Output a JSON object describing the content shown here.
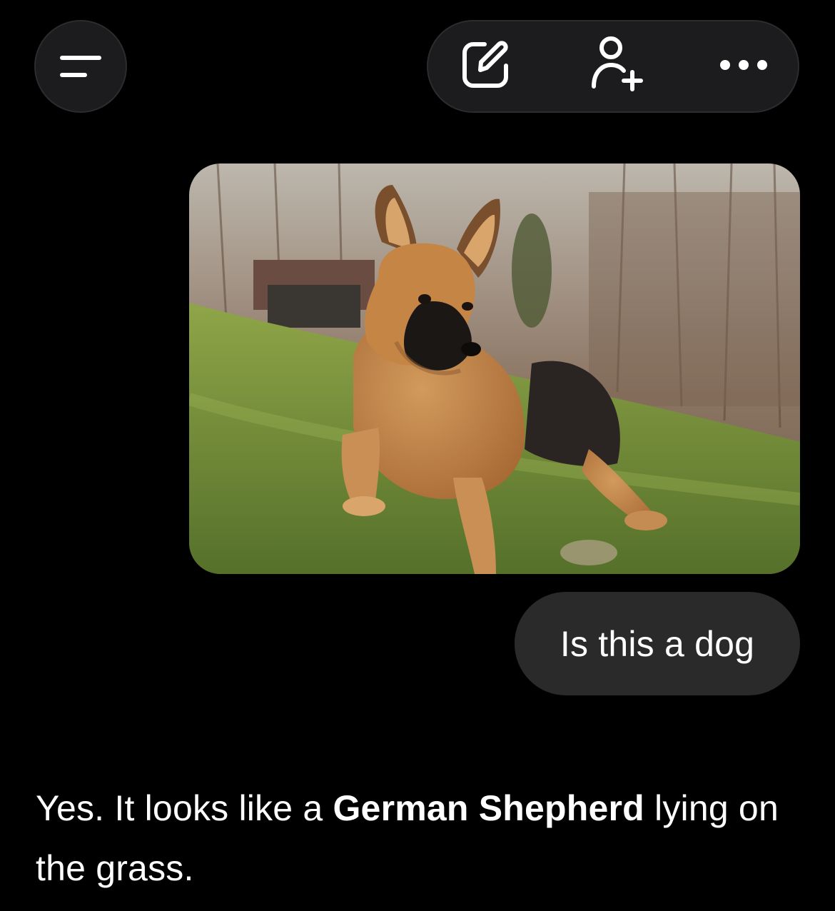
{
  "header": {
    "menu_icon": "menu-lines-icon",
    "toolbar": {
      "new_chat_icon": "edit-icon",
      "add_person_icon": "add-person-icon",
      "more_icon": "more-dots-icon"
    }
  },
  "conversation": {
    "user_image": {
      "icon": "photo-german-shepherd"
    },
    "user_message": "Is this a dog",
    "assistant_reply": {
      "before": "Yes. It looks like a ",
      "bold": "German Shepherd",
      "after": " lying on the grass."
    }
  },
  "colors": {
    "background": "#000000",
    "button_bg": "#1c1c1e",
    "bubble_bg": "#2a2a2a",
    "text": "#ffffff"
  }
}
